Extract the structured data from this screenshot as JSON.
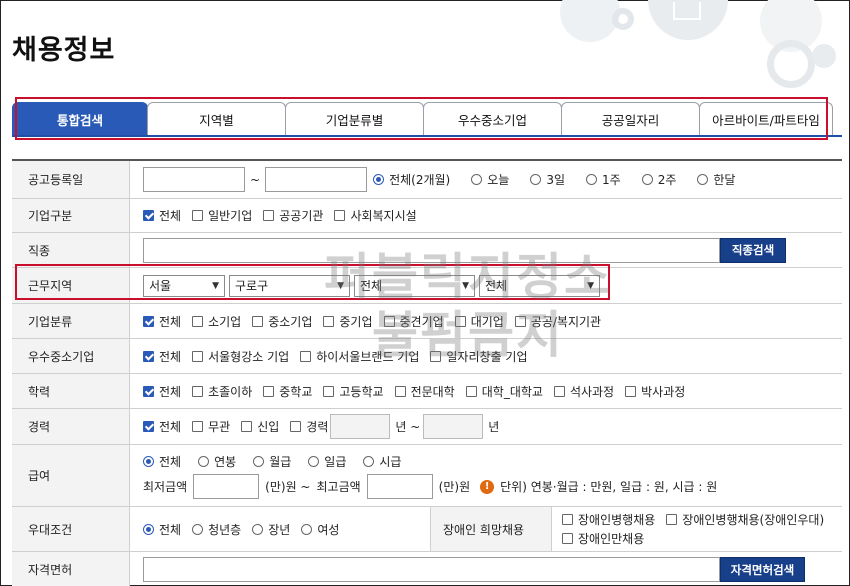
{
  "page": {
    "title": "채용정보"
  },
  "tabs": [
    {
      "label": "통합검색",
      "active": true
    },
    {
      "label": "지역별"
    },
    {
      "label": "기업분류별"
    },
    {
      "label": "우수중소기업"
    },
    {
      "label": "공공일자리"
    },
    {
      "label": "아르바이트/파트타임"
    }
  ],
  "form": {
    "posting_date": {
      "label": "공고등록일",
      "separator": "~",
      "options": [
        "전체(2개월)",
        "오늘",
        "3일",
        "1주",
        "2주",
        "한달"
      ],
      "selected": "전체(2개월)"
    },
    "company_type": {
      "label": "기업구분",
      "options": [
        "전체",
        "일반기업",
        "공공기관",
        "사회복지시설"
      ],
      "checked": [
        "전체"
      ]
    },
    "job_type": {
      "label": "직종",
      "button": "직종검색"
    },
    "work_region": {
      "label": "근무지역",
      "selects": [
        "서울",
        "구로구",
        "전체",
        "전체"
      ]
    },
    "company_class": {
      "label": "기업분류",
      "options": [
        "전체",
        "소기업",
        "중소기업",
        "중기업",
        "중견기업",
        "대기업",
        "공공/복지기관"
      ],
      "checked": [
        "전체"
      ]
    },
    "sme": {
      "label": "우수중소기업",
      "options": [
        "전체",
        "서울형강소 기업",
        "하이서울브랜드 기업",
        "일자리창출 기업"
      ],
      "checked": [
        "전체"
      ]
    },
    "education": {
      "label": "학력",
      "options": [
        "전체",
        "초졸이하",
        "중학교",
        "고등학교",
        "전문대학",
        "대학_대학교",
        "석사과정",
        "박사과정"
      ],
      "checked": [
        "전체"
      ]
    },
    "career": {
      "label": "경력",
      "options": [
        "전체",
        "무관",
        "신입",
        "경력"
      ],
      "checked": [
        "전체"
      ],
      "year_from": "년 ~",
      "year_to": "년"
    },
    "salary": {
      "label": "급여",
      "options": [
        "전체",
        "연봉",
        "월급",
        "일급",
        "시급"
      ],
      "selected": "전체",
      "min_label": "최저금액",
      "min_unit": "(만)원 ~",
      "max_label": "최고금액",
      "max_unit": "(만)원",
      "notice": "단위) 연봉·월급 : 만원, 일급 : 원, 시급 : 원"
    },
    "preference": {
      "label": "우대조건",
      "options": [
        "전체",
        "청년층",
        "장년",
        "여성"
      ],
      "selected": "전체",
      "disabled_label": "장애인 희망채용",
      "disabled_options": [
        "장애인병행채용",
        "장애인병행채용(장애인우대)",
        "장애인만채용"
      ]
    },
    "license": {
      "label": "자격면허",
      "button": "자격면허검색"
    }
  },
  "watermark": {
    "lines": [
      "퍼블릭지정소",
      "불펌금지"
    ]
  },
  "colors": {
    "tab_active": "#2a5ab7",
    "button": "#173f8a",
    "highlight": "#c8102e",
    "notice_icon": "#e06a12"
  }
}
